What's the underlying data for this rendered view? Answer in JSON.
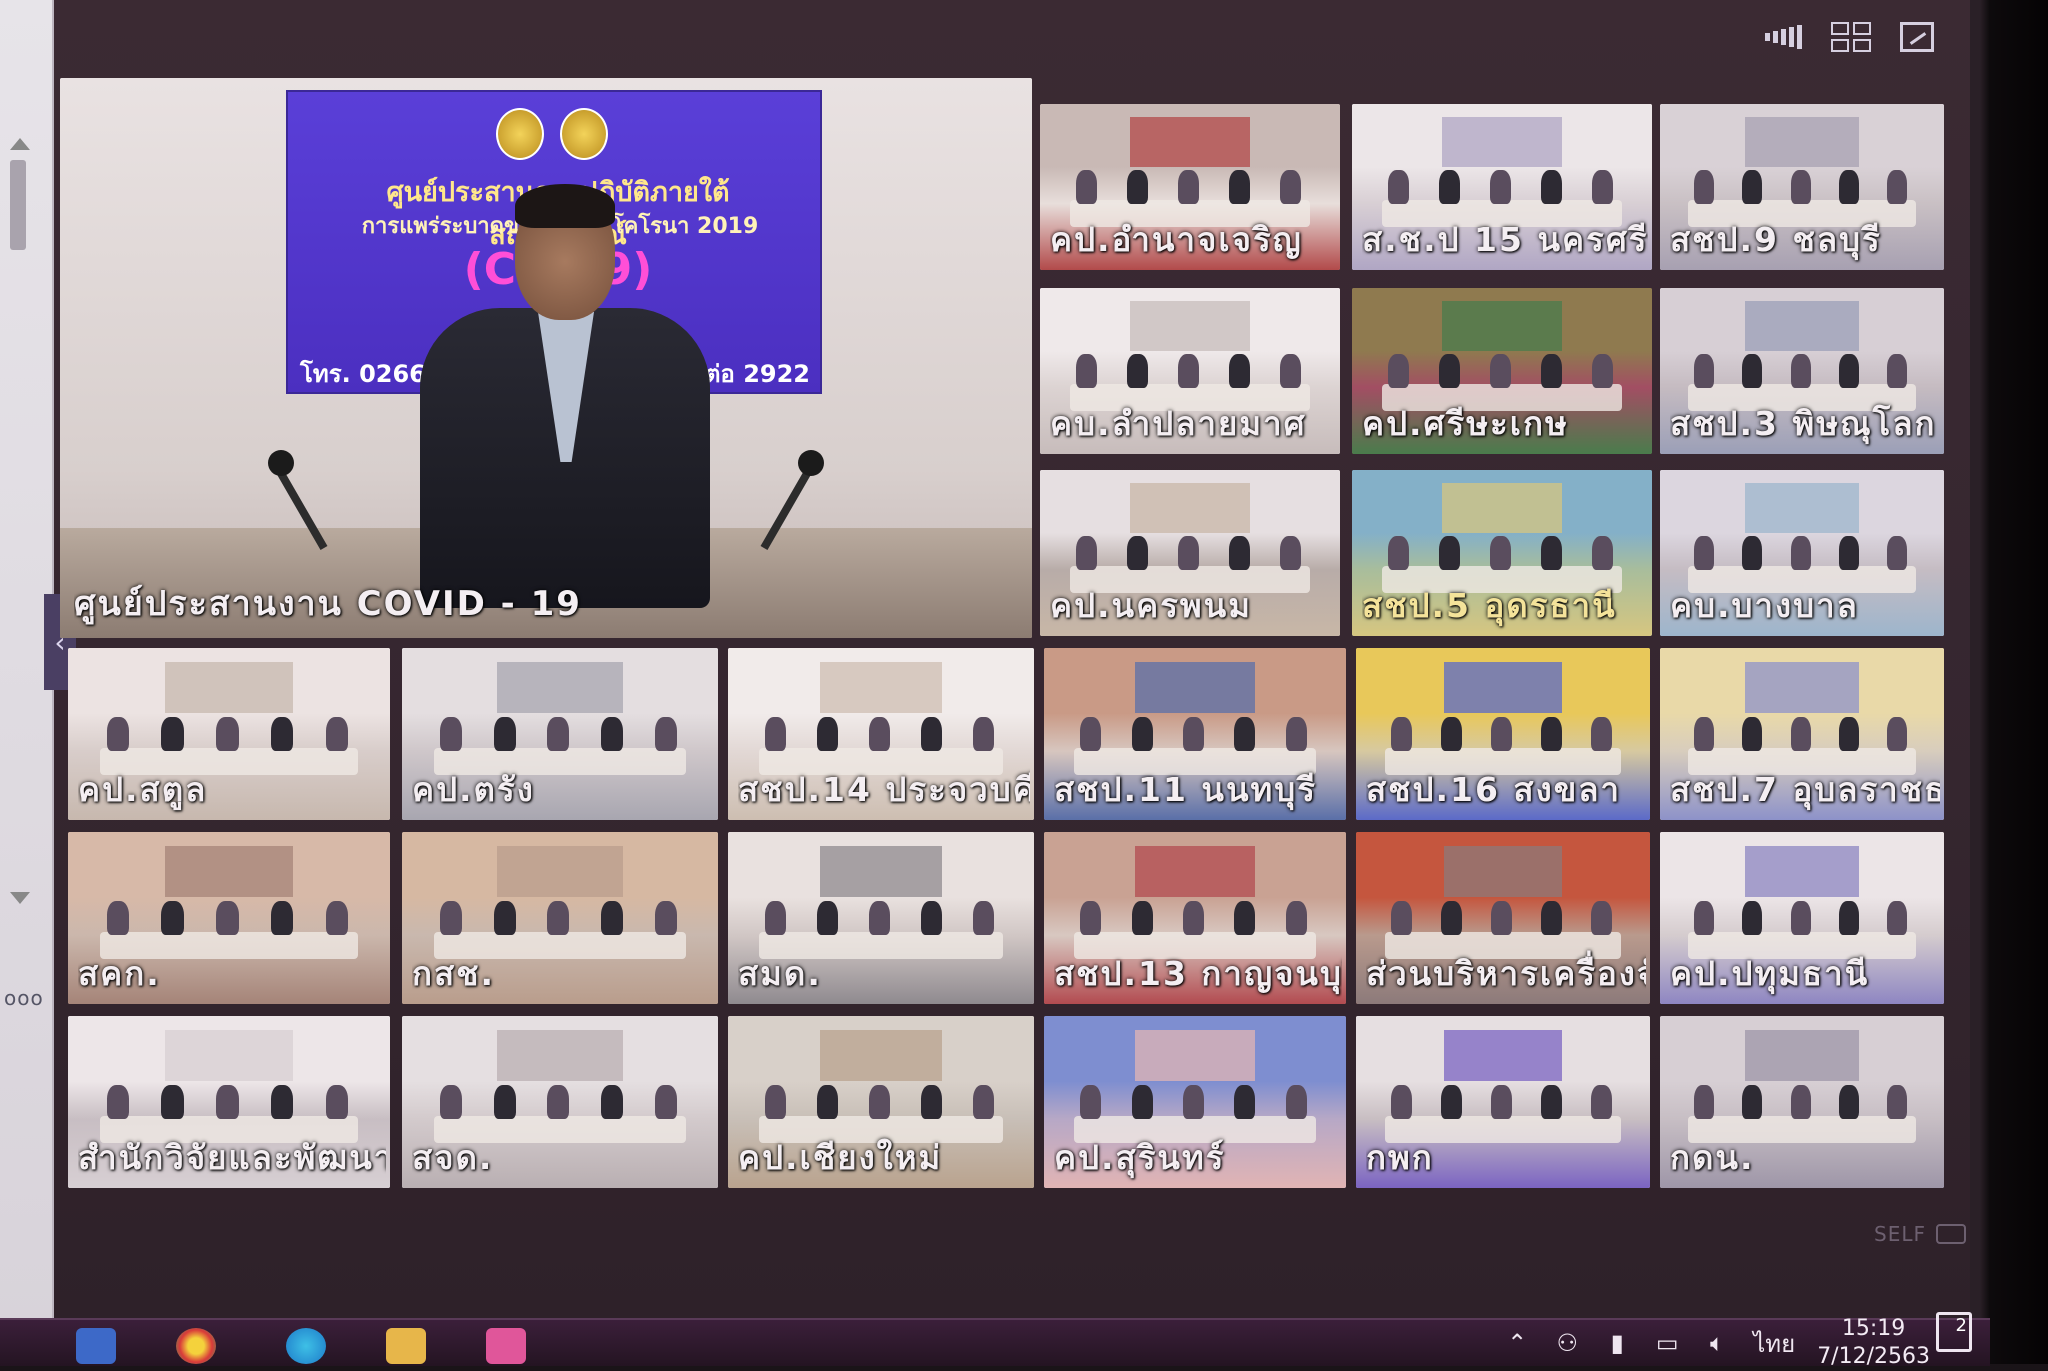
{
  "main_tile": {
    "label": "ศูนย์ประสานงาน COVID - 19",
    "banner_line1": "ศูนย์ประสานการปฏิบัติภายใต้สถานการณ์",
    "banner_line2": "การแพร่ระบาดของโร  วรัสโคโรนา 2019",
    "banner_line3": "(COV  9)",
    "banner_line4": "กรม  าน",
    "banner_tel_left": "โทร. 0266",
    "banner_tel_right": "ต่อ 2922"
  },
  "tiles": [
    {
      "label": "คป.อำนาจเจริญ",
      "palette": [
        "#c9b9b5",
        "#b24a4a",
        "#e8dedb"
      ]
    },
    {
      "label": "ส.ช.ป 15 นครศรีธ",
      "palette": [
        "#ece6e8",
        "#b0a6c4",
        "#d8cfd4"
      ]
    },
    {
      "label": "สชป.9 ชลบุรี",
      "palette": [
        "#d9d1d6",
        "#a7a0b1",
        "#c9c0c4"
      ]
    },
    {
      "label": "คบ.ลำปลายมาศ",
      "palette": [
        "#efe9ea",
        "#c7bcbb",
        "#dcd3d2"
      ]
    },
    {
      "label": "คป.ศรีษะเกษ",
      "palette": [
        "#8f7a4f",
        "#4a7c4c",
        "#a24e63"
      ]
    },
    {
      "label": "สชป.3 พิษณุโลก",
      "palette": [
        "#d7cfd5",
        "#9b9fb7",
        "#c5bbc1"
      ]
    },
    {
      "label": "คป.นครพนม",
      "palette": [
        "#e6dfe1",
        "#c8b7a7",
        "#b8aca8"
      ]
    },
    {
      "label": "สชป.5 อุดรธานี",
      "palette": [
        "#84b0c8",
        "#d6c680",
        "#a8bd9c"
      ]
    },
    {
      "label": "คบ.บางบาล",
      "palette": [
        "#dcd6df",
        "#9db5cc",
        "#c5bcc3"
      ]
    },
    {
      "label": "คป.สตูล",
      "palette": [
        "#ece3e2",
        "#c7b8ae",
        "#d8cdca"
      ]
    },
    {
      "label": "คป.ตรัง",
      "palette": [
        "#e4dee0",
        "#a8a6b0",
        "#cfc7ca"
      ]
    },
    {
      "label": "สชป.14 ประจวบคี",
      "palette": [
        "#f1ebea",
        "#cdbeb1",
        "#e2d8d5"
      ]
    },
    {
      "label": "สชป.11 นนทบุรี",
      "palette": [
        "#c99a86",
        "#5a6fa8",
        "#d7c6bf"
      ]
    },
    {
      "label": "สชป.16 สงขลา",
      "palette": [
        "#e8c85a",
        "#5b6ac8",
        "#d7c9a0"
      ]
    },
    {
      "label": "สชป.7 อุบลราชธา",
      "palette": [
        "#e9d9a8",
        "#8d92c9",
        "#d8cdbd"
      ]
    },
    {
      "label": "สคก.",
      "palette": [
        "#d7b9a8",
        "#a58478",
        "#cbb7ac"
      ]
    },
    {
      "label": "กสช.",
      "palette": [
        "#d6b8a2",
        "#b99d8c",
        "#c9b8ae"
      ]
    },
    {
      "label": "สมด.",
      "palette": [
        "#e9e1df",
        "#8f8a8f",
        "#d1c7c5"
      ]
    },
    {
      "label": "สชป.13 กาญจนบุรี",
      "palette": [
        "#c9a293",
        "#b24b50",
        "#d8c8c1"
      ]
    },
    {
      "label": "ส่วนบริหารเครื่องจั",
      "palette": [
        "#c5563e",
        "#8c7a7a",
        "#b99a8d"
      ]
    },
    {
      "label": "คป.ปทุมธานี",
      "palette": [
        "#ece5e7",
        "#8e86c2",
        "#d5ccce"
      ]
    },
    {
      "label": "สำนักวิจัยและพัฒนา",
      "palette": [
        "#ede6e8",
        "#d7cfd3",
        "#c8bec3"
      ]
    },
    {
      "label": "สจด.",
      "palette": [
        "#e5dfe1",
        "#b9afb2",
        "#d3cacc"
      ]
    },
    {
      "label": "คป.เชียงใหม่",
      "palette": [
        "#d8d0c9",
        "#b9a38e",
        "#c8bfb7"
      ]
    },
    {
      "label": "คป.สุรินทร์",
      "palette": [
        "#7e8ed0",
        "#e1b4b4",
        "#b7a8c6"
      ]
    },
    {
      "label": "กพก",
      "palette": [
        "#e6dfe1",
        "#7b64c2",
        "#c8bec2"
      ]
    },
    {
      "label": "กดน.",
      "palette": [
        "#d7cfd4",
        "#9e96a8",
        "#c7bec4"
      ]
    }
  ],
  "self_view_label": "SELF",
  "tray": {
    "language": "ไทย",
    "time": "15:19",
    "date": "7/12/2563",
    "notification_count": "2"
  }
}
